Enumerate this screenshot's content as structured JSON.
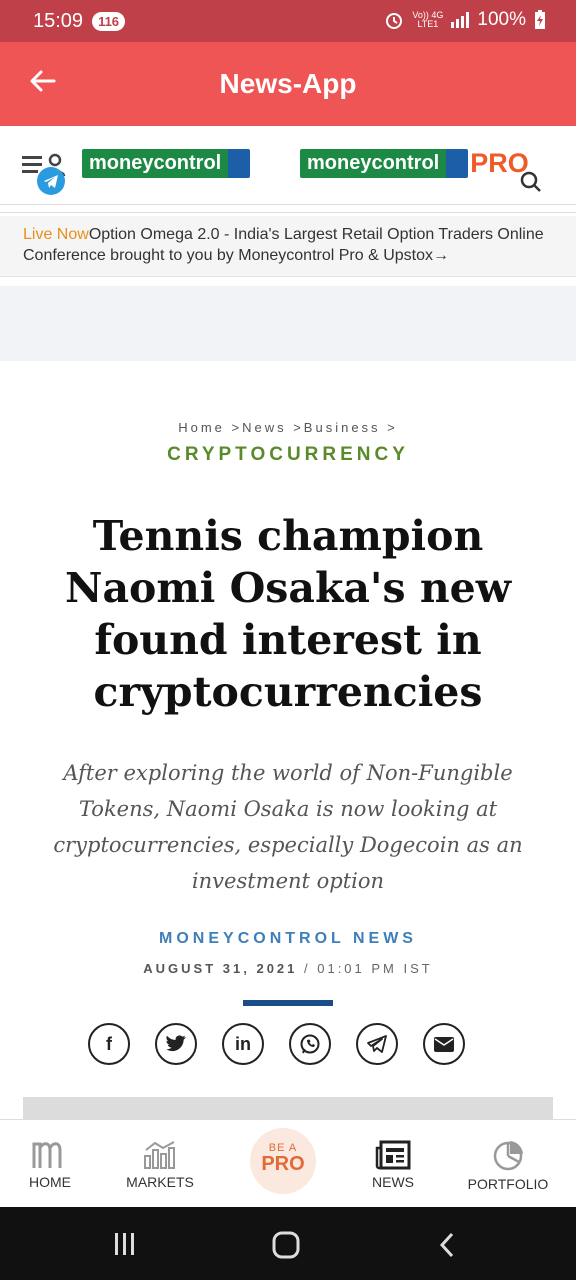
{
  "status": {
    "time": "15:09",
    "badge": "116",
    "network_top": "Vo)) 4G",
    "network_bottom": "LTE1",
    "battery": "100%"
  },
  "appbar": {
    "title": "News-App"
  },
  "header": {
    "logo_main": "moneycontrol",
    "logo_pro_main": "moneycontrol",
    "logo_pro_suffix": "PRO"
  },
  "live": {
    "tag": "Live Now",
    "text": "Option Omega 2.0 - India's Largest Retail Option Traders Online Conference brought to you by Moneycontrol Pro & Upstox",
    "arrow": "→"
  },
  "article": {
    "breadcrumb": "Home >News >Business >",
    "category": "CRYPTOCURRENCY",
    "headline": "Tennis champion Naomi Osaka's new found interest in cryptocurrencies",
    "subhead": "After exploring the world of Non-Fungible Tokens, Naomi Osaka is now looking at cryptocurrencies, especially Dogecoin as an investment option",
    "author": "MONEYCONTROL NEWS",
    "date": "AUGUST 31, 2021",
    "sep": " / ",
    "time": "01:01 PM IST"
  },
  "share": {
    "facebook": "f",
    "linkedin": "in"
  },
  "nav": {
    "home": "HOME",
    "markets": "MARKETS",
    "pro_top": "BE A",
    "pro_main": "PRO",
    "news": "NEWS",
    "portfolio": "PORTFOLIO"
  },
  "colors": {
    "status_bar": "#c0404a",
    "app_bar": "#f05555",
    "category": "#5a8a2a",
    "author": "#3e7fb9",
    "pro": "#e26a34"
  }
}
